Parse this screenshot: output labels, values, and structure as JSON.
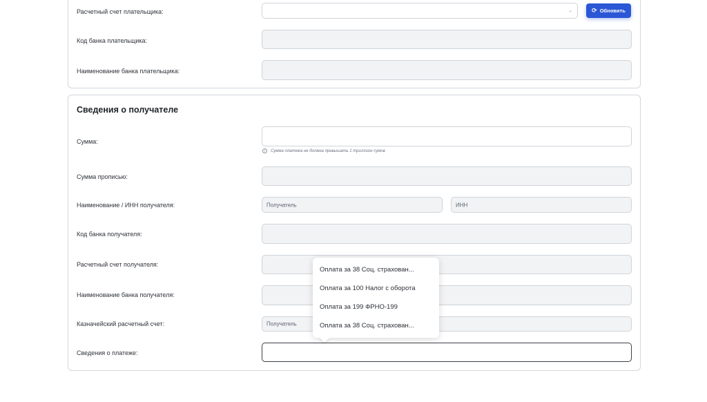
{
  "payer": {
    "account_label": "Расчетный счет плательщика:",
    "account_value": "",
    "refresh_button": "Обновить",
    "bank_code_label": "Код банка плательщика:",
    "bank_name_label": "Наименование банка плательщика:"
  },
  "recipient": {
    "section_title": "Сведения о получателе",
    "amount_label": "Сумма:",
    "amount_value": "",
    "amount_hint": "Сумма платежа не должна превышать 1 триллион сумов",
    "amount_words_label": "Сумма прописью:",
    "name_inn_label": "Наименование / ИНН получателя:",
    "name_placeholder": "Получатель",
    "inn_placeholder": "ИНН",
    "bank_code_label": "Код банка получателя:",
    "account_label": "Расчетный счет получателя:",
    "bank_name_label": "Наименование банка получателя:",
    "treasury_label": "Казначейский расчетный счет:",
    "treasury_placeholder": "Получатель",
    "payment_info_label": "Сведения о платеже:",
    "payment_info_value": ""
  },
  "suggestions": [
    "Оплата за 38 Соц. страхован...",
    "Оплата за 100 Налог с оборота",
    "Оплата за 199 ФРНО-199",
    "Оплата за 38 Соц. страхован..."
  ],
  "icons": {
    "refresh": "refresh-icon",
    "chevron": "chevron-down-icon",
    "info": "info-icon"
  },
  "colors": {
    "primary": "#2b57d6",
    "border": "#d3d6dc",
    "field_disabled": "#f2f3f5"
  }
}
